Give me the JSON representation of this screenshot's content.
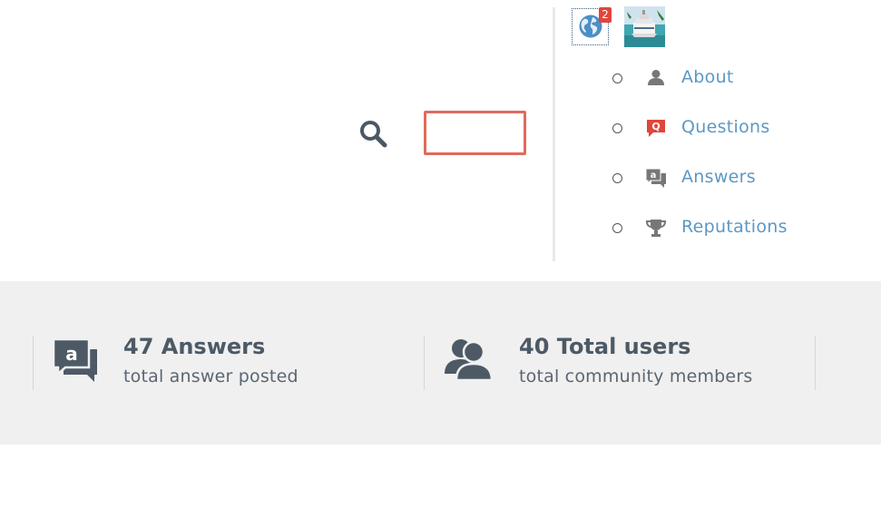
{
  "search": {
    "placeholder": "",
    "value": "",
    "icon": "search-icon"
  },
  "header": {
    "notifications": {
      "icon": "globe-icon",
      "count": "2"
    },
    "avatar": {
      "icon": "avatar-ship-image"
    }
  },
  "user_menu": [
    {
      "label": "About",
      "icon": "user-icon",
      "icon_color": "#777777"
    },
    {
      "label": "Questions",
      "icon": "question-icon",
      "icon_color": "#e0463b"
    },
    {
      "label": "Answers",
      "icon": "answers-icon",
      "icon_color": "#777777"
    },
    {
      "label": "Reputations",
      "icon": "trophy-icon",
      "icon_color": "#777777"
    }
  ],
  "stats": [
    {
      "title": "47 Answers",
      "subtitle": "total answer posted",
      "icon": "answers-chat-icon"
    },
    {
      "title": "40 Total users",
      "subtitle": "total community members",
      "icon": "users-icon"
    }
  ],
  "colors": {
    "link": "#5d98c4",
    "accent_red": "#e0463b",
    "search_border": "#e06a5c",
    "band_bg": "#f0f0f0",
    "stat_text": "#4d5a66"
  }
}
